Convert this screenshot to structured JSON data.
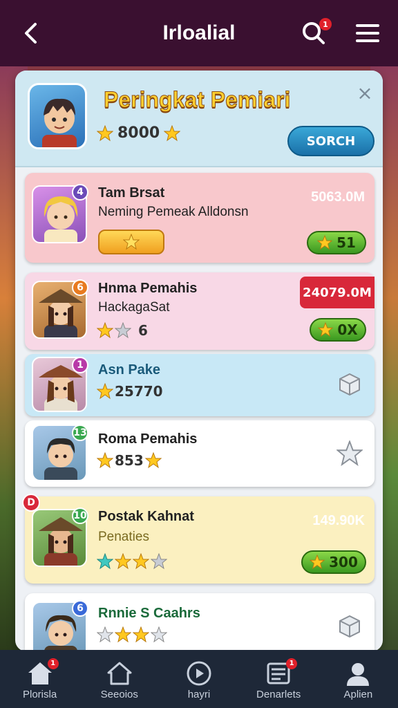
{
  "topbar": {
    "title": "Irloalial",
    "notification_count": "1"
  },
  "header": {
    "title": "Peringkat Pemiari",
    "score": "8000",
    "search_label": "SORCH",
    "close_symbol": "×"
  },
  "rows": [
    {
      "rank": "4",
      "name": "Tam Brsat",
      "sub": "Neming Pemeak Alldonsn",
      "right_value": "5063.0M",
      "pill_value": "51",
      "bg": "#f8c8cc",
      "rank_color": "#6a4ab8"
    },
    {
      "rank": "6",
      "name": "Hnma Pemahis",
      "sub": "HackagaSat",
      "score": "6",
      "tag_value": "24079.0M",
      "pill_value": "0X",
      "bg": "#f8d8e6",
      "rank_color": "#e87a20"
    },
    {
      "rank": "1",
      "name": "Asn Pake",
      "score": "25770",
      "bg": "#c8e8f6",
      "rank_color": "#b83aa8"
    },
    {
      "rank": "13",
      "name": "Roma Pemahis",
      "score": "853",
      "bg": "#ffffff",
      "rank_color": "#3aa850"
    },
    {
      "rank": "10",
      "name": "Postak Kahnat",
      "sub": "Penaties",
      "right_value": "149.90K",
      "pill_value": "300",
      "bg": "#fbf0c0",
      "rank_color": "#3aa850",
      "corner_badge": "D"
    },
    {
      "rank": "6",
      "name": "Rnnie S Caahrs",
      "bg": "#ffffff",
      "rank_color": "#3a6ad8"
    }
  ],
  "nav": [
    {
      "label": "Plorisla",
      "icon": "home-icon",
      "badge": "1"
    },
    {
      "label": "Seeoios",
      "icon": "house-outline-icon"
    },
    {
      "label": "hayri",
      "icon": "play-icon"
    },
    {
      "label": "Denarlets",
      "icon": "news-icon",
      "badge": "1"
    },
    {
      "label": "Aplien",
      "icon": "profile-icon"
    }
  ]
}
